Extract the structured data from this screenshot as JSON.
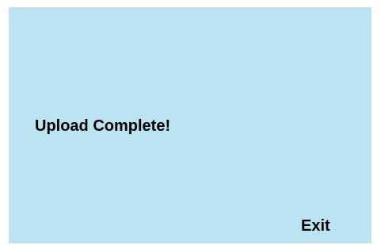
{
  "dialog": {
    "message": "Upload Complete!",
    "exit_label": "Exit",
    "background_color": "#bbe3f2",
    "text_color": "#000000"
  }
}
